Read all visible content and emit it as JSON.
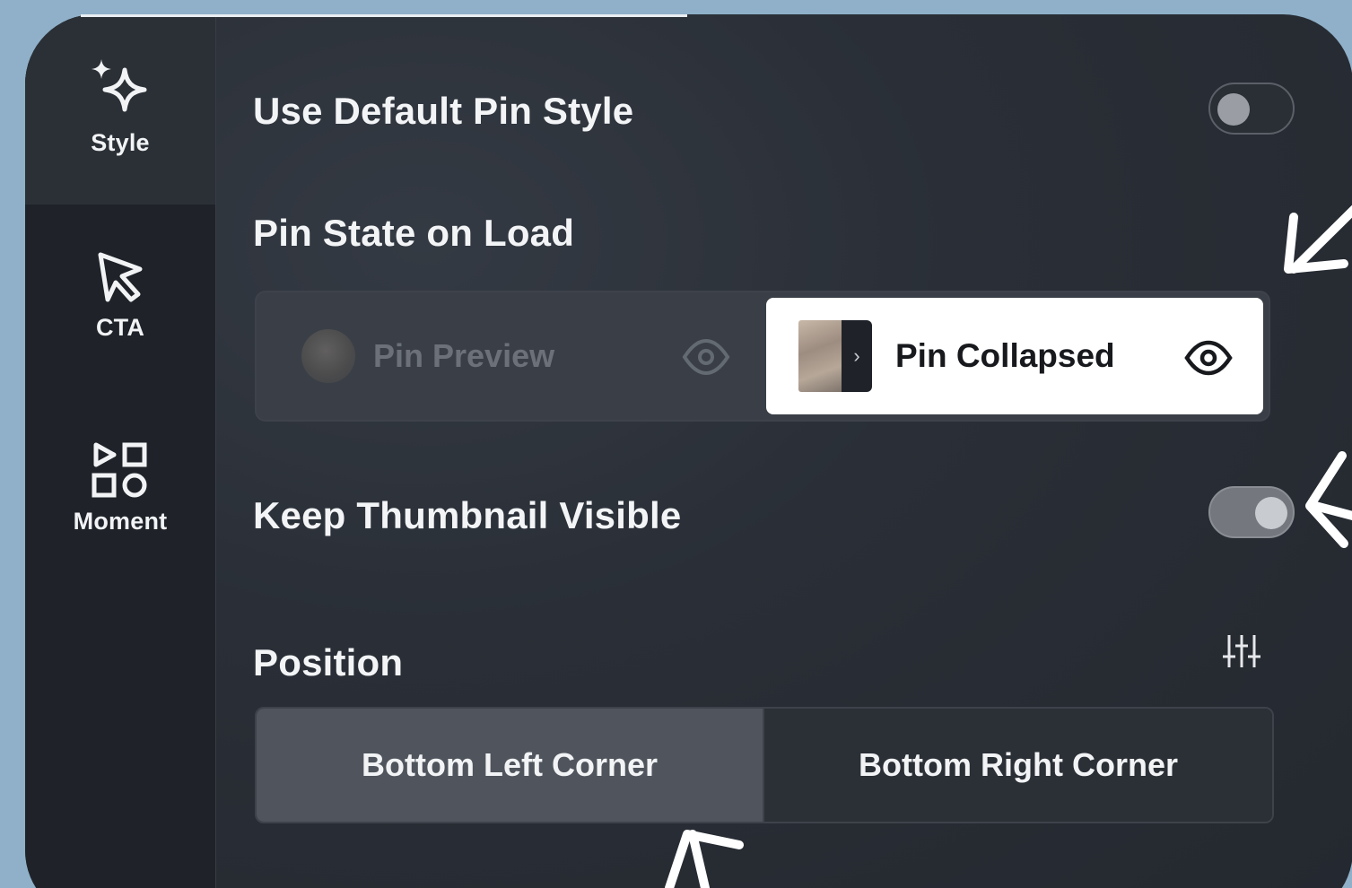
{
  "sidebar": {
    "items": [
      {
        "label": "Style",
        "icon": "sparkle-icon",
        "active": true
      },
      {
        "label": "CTA",
        "icon": "cursor-arrow-icon",
        "active": false
      },
      {
        "label": "Moment",
        "icon": "shapes-icon",
        "active": false
      }
    ]
  },
  "settings": {
    "default_pin_style": {
      "label": "Use Default Pin Style",
      "enabled": false
    },
    "pin_state": {
      "label": "Pin State on Load",
      "options": [
        {
          "label": "Pin Preview",
          "icon": "eye-icon",
          "selected": false
        },
        {
          "label": "Pin Collapsed",
          "icon": "eye-icon",
          "selected": true
        }
      ]
    },
    "keep_thumbnail": {
      "label": "Keep Thumbnail Visible",
      "enabled": true
    },
    "position": {
      "label": "Position",
      "icon": "sliders-icon",
      "options": [
        {
          "label": "Bottom Left Corner",
          "selected": true
        },
        {
          "label": "Bottom Right Corner",
          "selected": false
        }
      ]
    }
  },
  "colors": {
    "background": "#8fb0c8",
    "panel": "#2a2f37",
    "sidebar": "#1f2329",
    "selected_option": "#ffffff",
    "annotation": "#ffffff"
  },
  "annotations": [
    "arrow-icon",
    "arrow-icon",
    "arrow-icon"
  ]
}
